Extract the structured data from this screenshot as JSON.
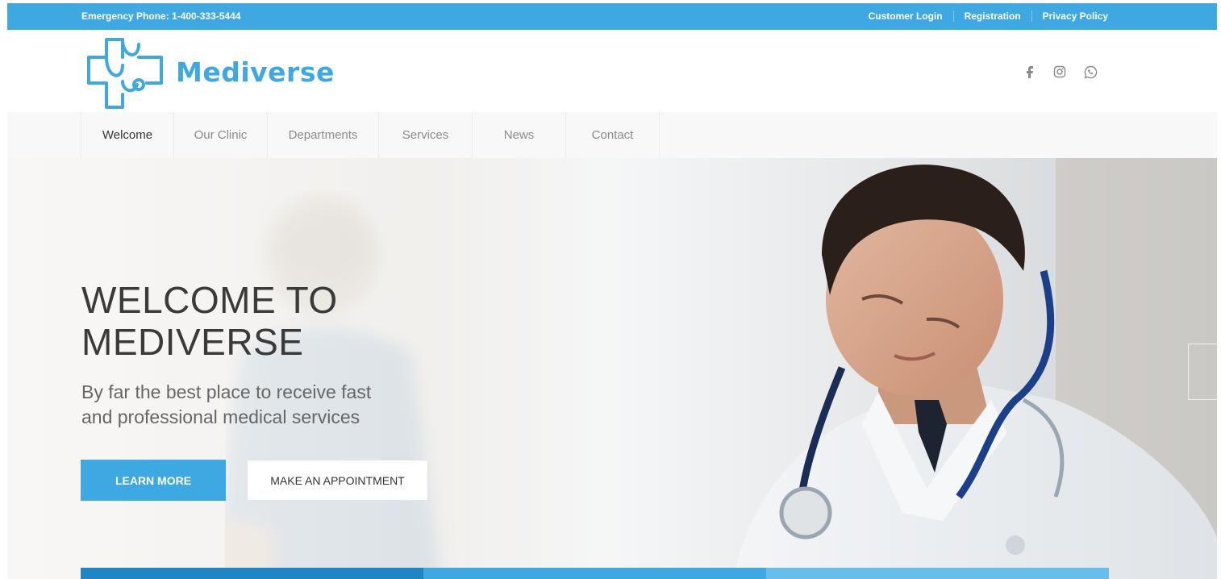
{
  "topbar": {
    "phone": "Emergency Phone: 1-400-333-5444",
    "links": [
      "Customer Login",
      "Registration",
      "Privacy Policy"
    ]
  },
  "header": {
    "brand": "Mediverse",
    "social": [
      "facebook-icon",
      "instagram-icon",
      "whatsapp-icon"
    ]
  },
  "nav": {
    "items": [
      "Welcome",
      "Our Clinic",
      "Departments",
      "Services",
      "News",
      "Contact"
    ],
    "active": "Welcome"
  },
  "hero": {
    "title_line1": "WELCOME TO",
    "title_line2": "MEDIVERSE",
    "subtitle_line1": "By far the best place to receive fast",
    "subtitle_line2": "and professional medical services",
    "primary_button": "LEARN MORE",
    "secondary_button": "MAKE AN APPOINTMENT"
  },
  "colors": {
    "brand": "#3ea8e3",
    "strip": [
      "#1f86c6",
      "#3ea8e3",
      "#67bdeb"
    ]
  }
}
